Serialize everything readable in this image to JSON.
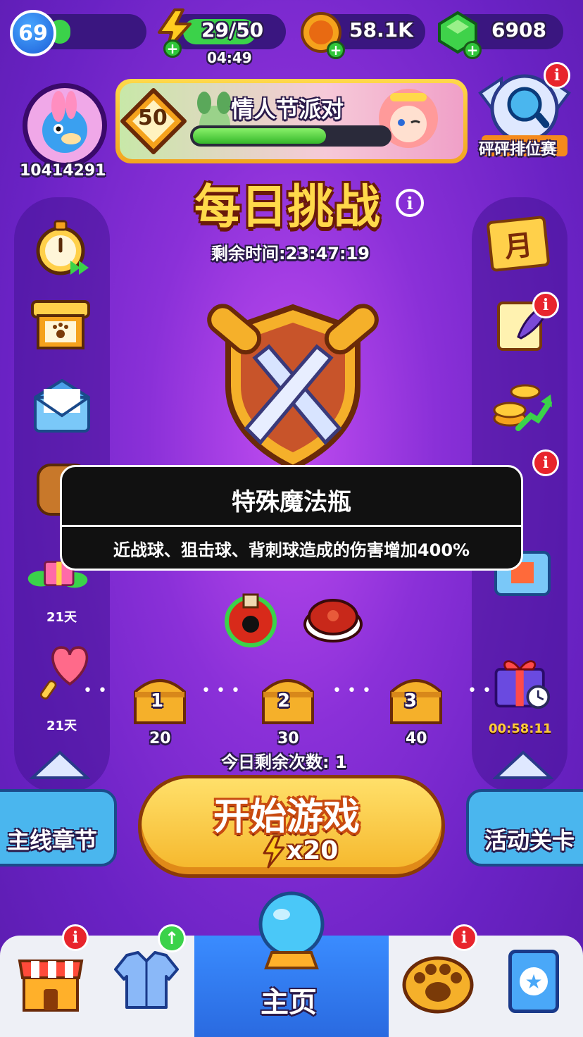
{
  "top_bar": {
    "level": "69",
    "energy": "29/50",
    "energy_timer": "04:49",
    "coins": "58.1K",
    "gems": "6908"
  },
  "profile": {
    "player_id": "10414291"
  },
  "event_banner": {
    "title": "情人节派对",
    "level": "50",
    "progress": 0.66
  },
  "rank_button": {
    "label": "砰砰排位赛"
  },
  "challenge": {
    "title": "每日挑战",
    "time_remaining": "剩余时间:23:47:19",
    "remaining_tries": "今日剩余次数: 1"
  },
  "tooltip": {
    "title": "特殊魔法瓶",
    "description": "近战球、狙击球、背刺球造成的伤害增加400%"
  },
  "left_side": {
    "gift_days": "21天",
    "lollipop_days": "21天"
  },
  "right_side": {
    "calendar_char": "月",
    "gift_timer": "00:58:11"
  },
  "chests": [
    {
      "num": "1",
      "value": "20"
    },
    {
      "num": "2",
      "value": "30"
    },
    {
      "num": "3",
      "value": "40"
    }
  ],
  "start_button": {
    "label": "开始游戏",
    "cost": "x20"
  },
  "chapter_buttons": {
    "left": "主线章节",
    "right": "活动关卡"
  },
  "bottom_nav": {
    "home": "主页"
  },
  "colors": {
    "accent": "#ffd94a",
    "background": "#8a30d8",
    "badge": "#e8242c",
    "home_tab": "#3a8cff"
  }
}
